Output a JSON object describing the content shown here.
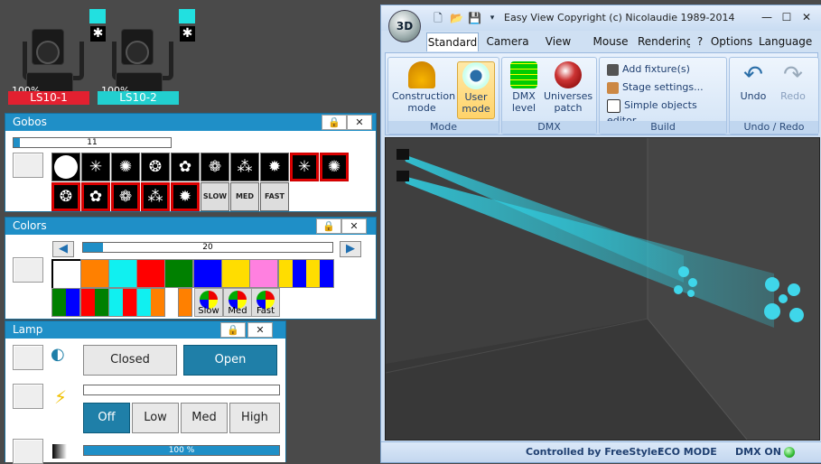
{
  "fixtures": [
    {
      "label": "LS10-1",
      "percent": "100%",
      "label_color": "#e32030"
    },
    {
      "label": "LS10-2",
      "percent": "100%",
      "label_color": "#22cfcf"
    }
  ],
  "gobos": {
    "title": "Gobos",
    "slider_value": "11",
    "slider_fraction": 0.04,
    "speed": [
      "SLOW",
      "MED",
      "FAST"
    ],
    "lock_icon": "lock-icon",
    "close_icon": "close-icon"
  },
  "colors": {
    "title": "Colors",
    "slider_value": "20",
    "slider_fraction": 0.08,
    "row1": [
      "#ffffff",
      "#ff8000",
      "#10f0f0",
      "#ff0000",
      "#008000",
      "#0000ff",
      "#ffdd00",
      "#ff80e0"
    ],
    "wheels": [
      "Slow",
      "Med",
      "Fast"
    ]
  },
  "lamp": {
    "title": "Lamp",
    "closed": "Closed",
    "open": "Open",
    "off": "Off",
    "low": "Low",
    "med": "Med",
    "high": "High",
    "dimmer": "100 %",
    "dimmer_fraction": 1.0
  },
  "window": {
    "title": "Easy View   Copyright (c) Nicolaudie 1989-2014",
    "orb": "3D",
    "tabs": [
      "Standard t",
      "Camera",
      "View",
      "Mouse",
      "Rendering",
      "?",
      "Options",
      "Language"
    ],
    "groups": {
      "mode": "Mode",
      "dmx": "DMX",
      "build": "Build",
      "undo_redo": "Undo / Redo"
    },
    "buttons": {
      "construction": "Construction mode",
      "user": "User mode",
      "dmx_level": "DMX level",
      "universes": "Universes patch",
      "add_fixture": "Add fixture(s)",
      "stage": "Stage settings...",
      "simple": "Simple objects editor",
      "undo": "Undo",
      "redo": "Redo"
    },
    "status": {
      "controlled": "Controlled by FreeStyler",
      "eco": "ECO MODE",
      "dmx": "DMX ON"
    }
  }
}
